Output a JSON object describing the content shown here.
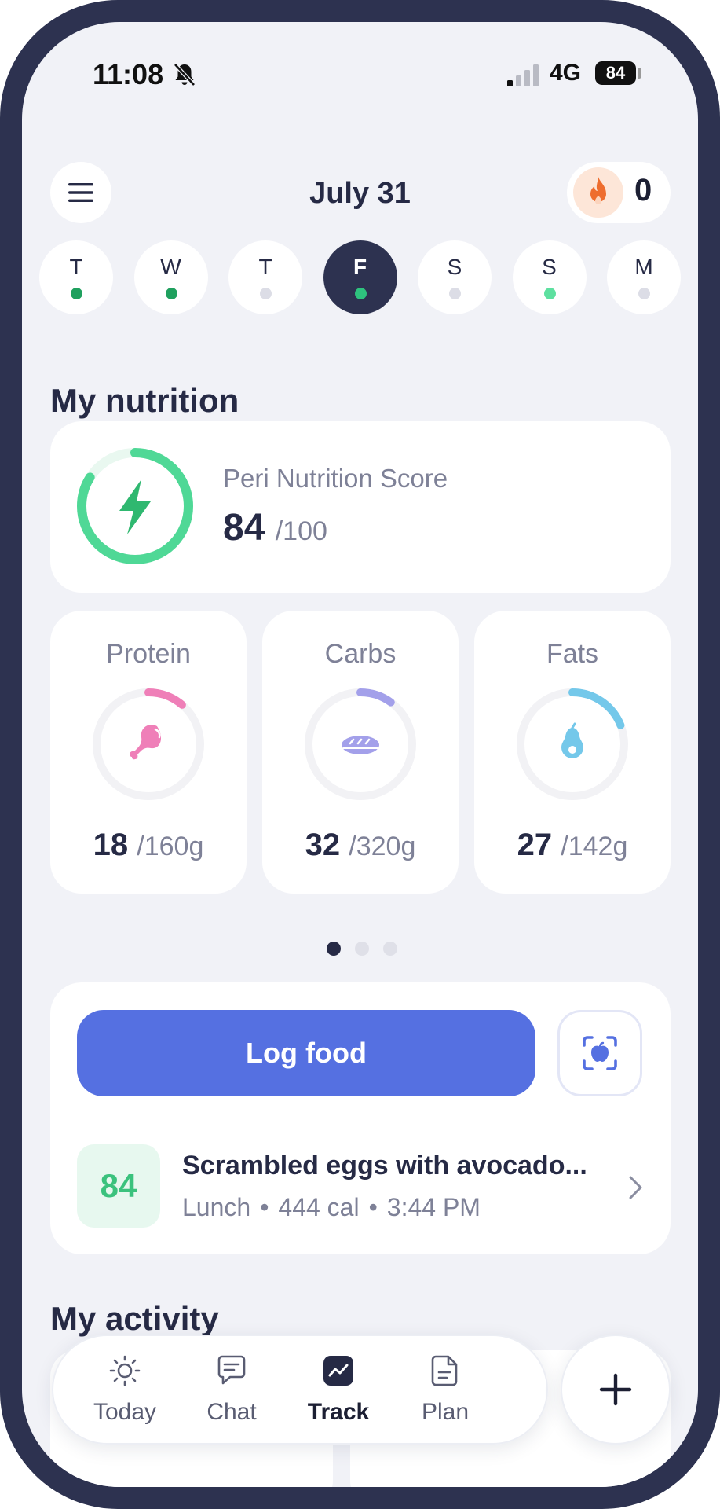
{
  "status_bar": {
    "time": "11:08",
    "network": "4G",
    "battery": "84",
    "icons": [
      "bell-slash-icon",
      "signal-icon"
    ]
  },
  "header": {
    "date": "July 31",
    "streak_count": "0",
    "icons": [
      "menu-icon",
      "flame-icon"
    ]
  },
  "week": {
    "days": [
      {
        "letter": "T",
        "dot_color": "#1fa05e"
      },
      {
        "letter": "W",
        "dot_color": "#1fa05e"
      },
      {
        "letter": "T",
        "dot_color": "#dcdde6"
      },
      {
        "letter": "F",
        "dot_color": "#2ec27e",
        "active": true
      },
      {
        "letter": "S",
        "dot_color": "#dcdde6"
      },
      {
        "letter": "S",
        "dot_color": "#5ee0a0"
      },
      {
        "letter": "M",
        "dot_color": "#dcdde6"
      }
    ]
  },
  "nutrition": {
    "title": "My nutrition",
    "score_label": "Peri Nutrition Score",
    "score": "84",
    "score_max": "/100",
    "score_fraction": 0.84,
    "macros": [
      {
        "label": "Protein",
        "value": "18",
        "target": "/160g",
        "fraction": 0.1125,
        "color": "#ef7fb8",
        "icon": "drumstick-icon"
      },
      {
        "label": "Carbs",
        "value": "32",
        "target": "/320g",
        "fraction": 0.1,
        "color": "#a3a0ea",
        "icon": "bread-icon"
      },
      {
        "label": "Fats",
        "value": "27",
        "target": "/142g",
        "fraction": 0.19,
        "color": "#74c8ea",
        "icon": "avocado-icon"
      }
    ],
    "pager_active": 0,
    "pager_count": 3
  },
  "log": {
    "button_label": "Log food",
    "scan_icon": "camera-scan-icon",
    "meal": {
      "score": "84",
      "name": "Scrambled eggs with avocado...",
      "type": "Lunch",
      "calories": "444 cal",
      "time": "3:44 PM",
      "separator": "•"
    }
  },
  "activity": {
    "title": "My activity"
  },
  "tabbar": {
    "tabs": [
      {
        "label": "Today",
        "icon": "sun-icon"
      },
      {
        "label": "Chat",
        "icon": "chat-icon"
      },
      {
        "label": "Track",
        "icon": "chart-icon",
        "active": true
      },
      {
        "label": "Plan",
        "icon": "document-icon"
      }
    ],
    "add_icon": "plus-icon"
  },
  "colors": {
    "accent": "#5570e1",
    "score_ring": "#4fd896",
    "frame": "#2d3250"
  }
}
